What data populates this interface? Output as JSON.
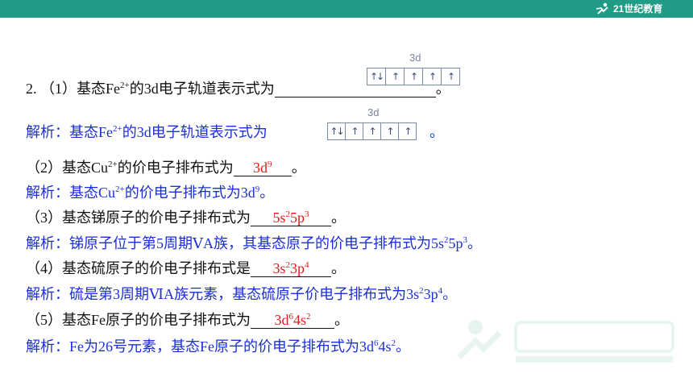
{
  "header": {
    "logo_text": "21世纪教育",
    "bar_color": "#1f9b86"
  },
  "orbital": {
    "label": "3d",
    "cells": [
      "↑↓",
      "↑",
      "↑",
      "↑",
      "↑"
    ]
  },
  "q1": {
    "prefix": "2. （1）基态Fe",
    "sup": "2+",
    "suffix": "的3d电子轨道表示式为",
    "end": "。"
  },
  "a1": {
    "prefix": "解析：基态Fe",
    "sup": "2+",
    "suffix": "的3d电子轨道表示式为",
    "end": "。"
  },
  "q2": {
    "prefix": "（2）基态Cu",
    "sup": "2+",
    "suffix": "的价电子排布式为",
    "answer_base": "3d",
    "answer_sup": "9",
    "end": "。"
  },
  "a2": {
    "prefix": "解析：基态Cu",
    "sup": "2+",
    "mid": "的价电子排布式为3d",
    "sup2": "9",
    "end": "。"
  },
  "q3": {
    "text": "（3）基态锑原子的价电子排布式为",
    "ans_a": "5s",
    "ans_a_sup": "2",
    "ans_b": "5p",
    "ans_b_sup": "3",
    "end": "。"
  },
  "a3": {
    "text": "解析：锑原子位于第5周期ⅤA族，其基态原子的价电子排布式为5s",
    "s1": "2",
    "mid": "5p",
    "s2": "3",
    "end": "。"
  },
  "q4": {
    "text": "（4）基态硫原子的价电子排布式是",
    "ans_a": "3s",
    "ans_a_sup": "2",
    "ans_b": "3p",
    "ans_b_sup": "4",
    "end": "。"
  },
  "a4": {
    "text": "解析：硫是第3周期ⅥA族元素，基态硫原子价电子排布式为3s",
    "s1": "2",
    "mid": "3p",
    "s2": "4",
    "end": "。"
  },
  "q5": {
    "text": "（5）基态Fe原子的价电子排布式为",
    "ans_a": "3d",
    "ans_a_sup": "6",
    "ans_b": "4s",
    "ans_b_sup": "2",
    "end": "。"
  },
  "a5": {
    "text": "解析：Fe为26号元素，基态Fe原子的价电子排布式为3d",
    "s1": "6",
    "mid": "4s",
    "s2": "2",
    "end": "。"
  }
}
